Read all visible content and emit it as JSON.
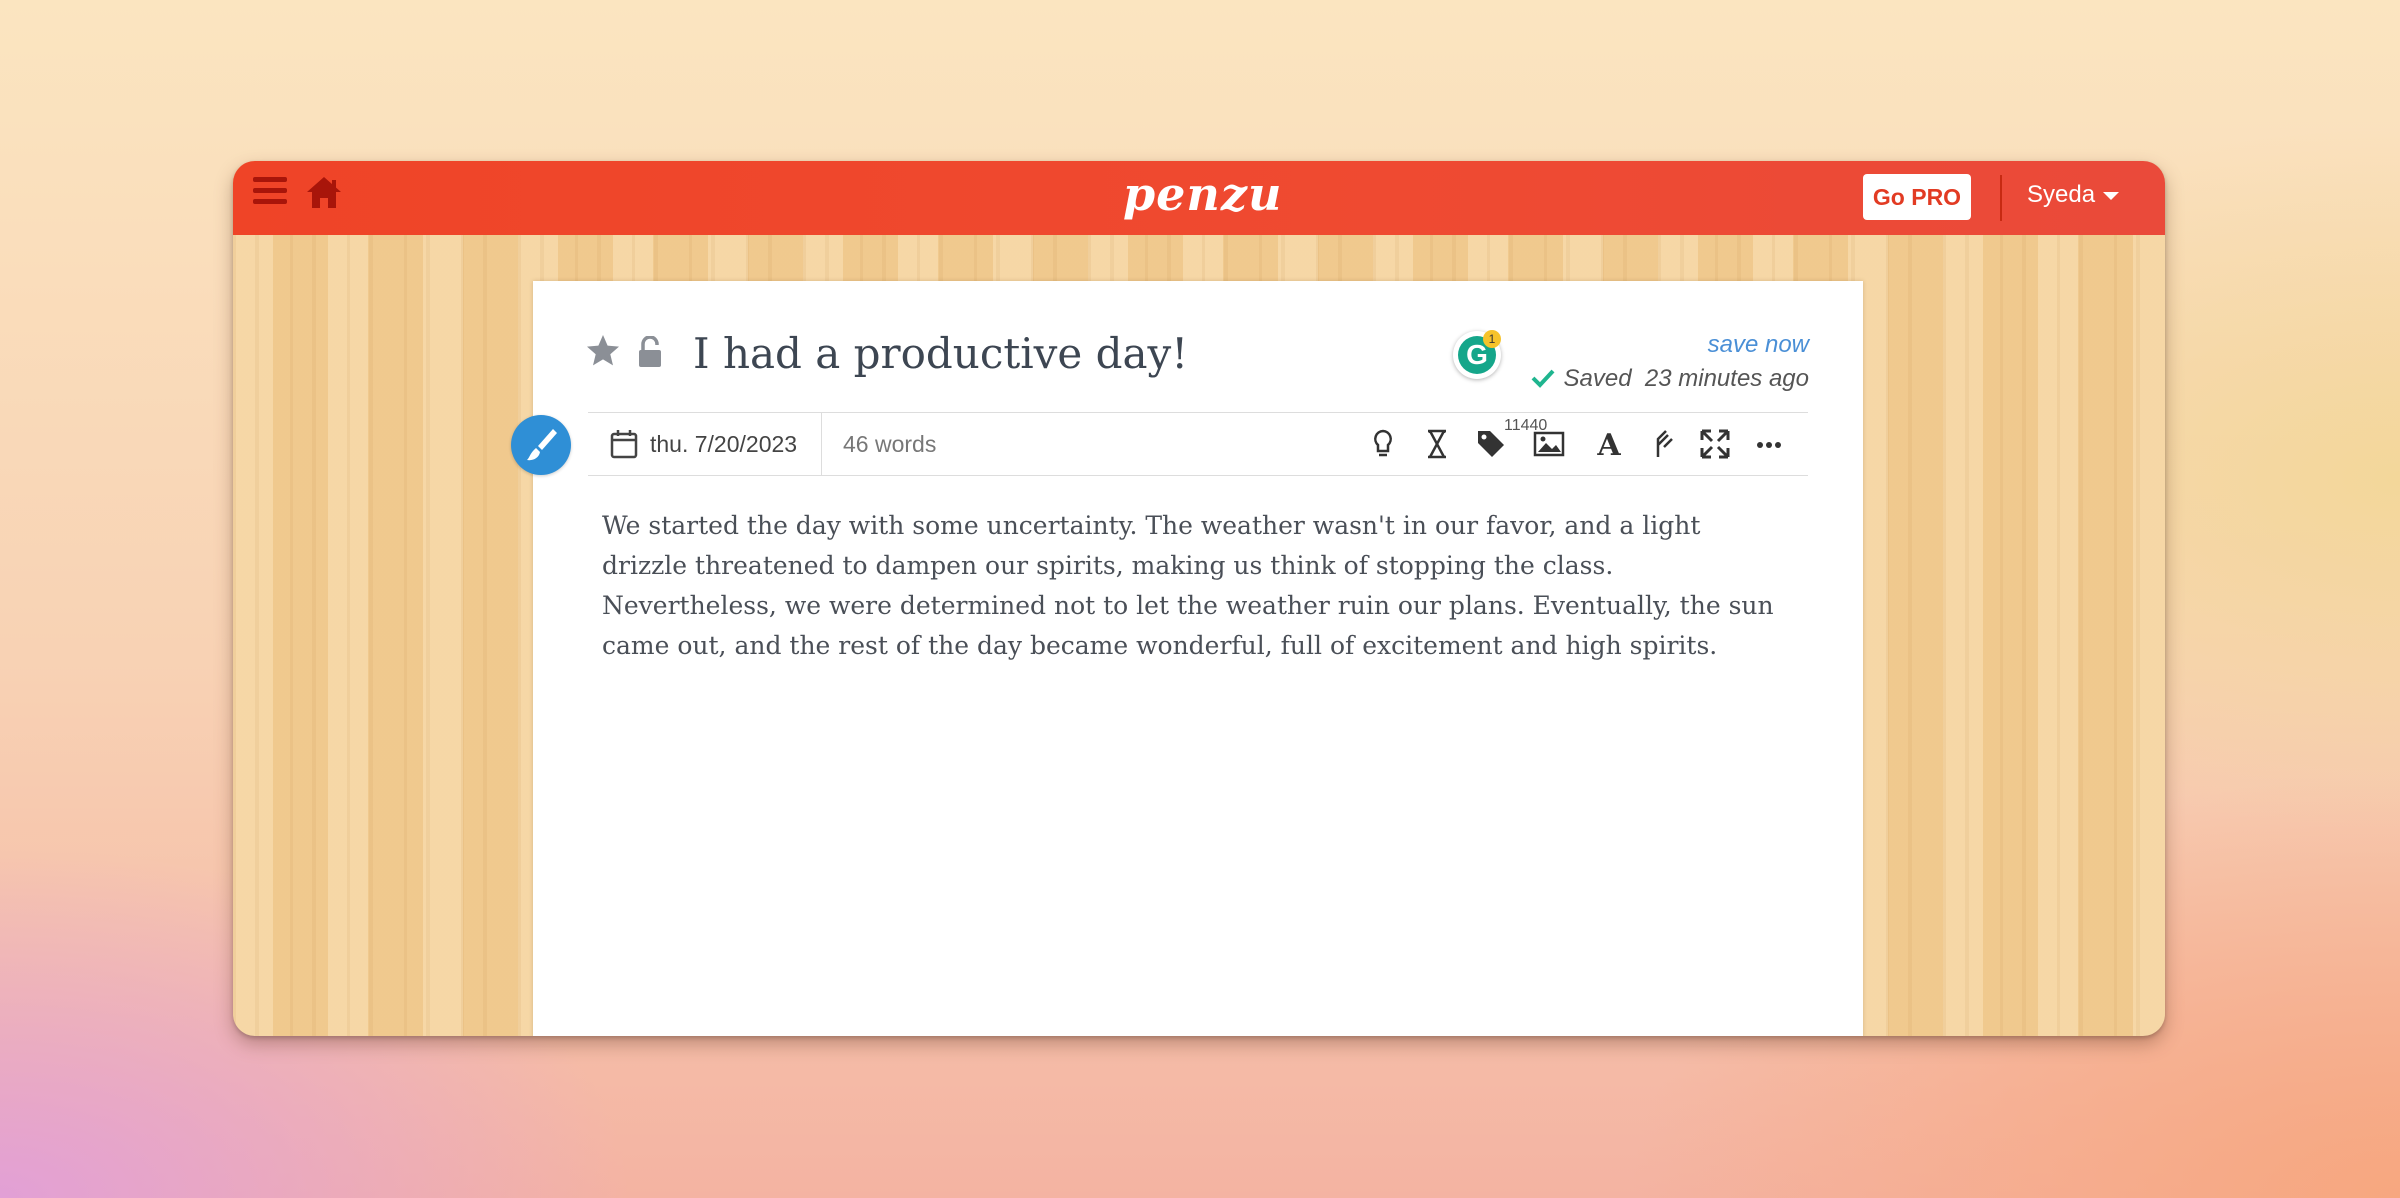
{
  "header": {
    "logo_text": "penzu",
    "go_pro_label": "Go PRO",
    "user_name": "Syeda"
  },
  "entry": {
    "title": "I had a productive day!",
    "date": "thu. 7/20/2023",
    "word_count": "46 words",
    "save_now_label": "save now",
    "saved_label": "Saved",
    "saved_time": "23 minutes ago",
    "body": "We started the day with some uncertainty. The weather wasn't in our favor, and a light drizzle threatened to dampen our spirits, making us think of stopping the class. Nevertheless, we were determined not to let the weather ruin our plans. Eventually, the sun came out, and the rest of the day became wonderful, full of excitement and high spirits."
  },
  "grammarly": {
    "letter": "G",
    "badge_count": "1"
  },
  "toolbar": {
    "tag_count": "11440"
  },
  "colors": {
    "brand_red": "#ef4427",
    "accent_blue": "#2f8fd6",
    "saved_green": "#1fb58f"
  }
}
